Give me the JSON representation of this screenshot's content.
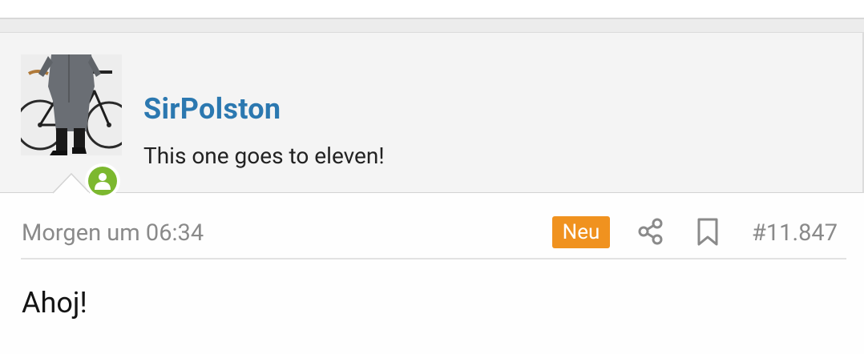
{
  "post": {
    "username": "SirPolston",
    "user_title": "This one goes to eleven!",
    "timestamp": "Morgen um 06:34",
    "new_badge": "Neu",
    "post_number": "#11.847",
    "message": "Ahoj!"
  },
  "icons": {
    "avatar": "user-avatar-photo",
    "online": "online-person-icon",
    "share": "share-icon",
    "bookmark": "bookmark-icon"
  },
  "colors": {
    "username": "#2b78b0",
    "new_badge": "#f0921f",
    "online_badge": "#7cb82f",
    "panel_bg": "#f4f4f4",
    "meta_text": "#8a8a8a"
  }
}
